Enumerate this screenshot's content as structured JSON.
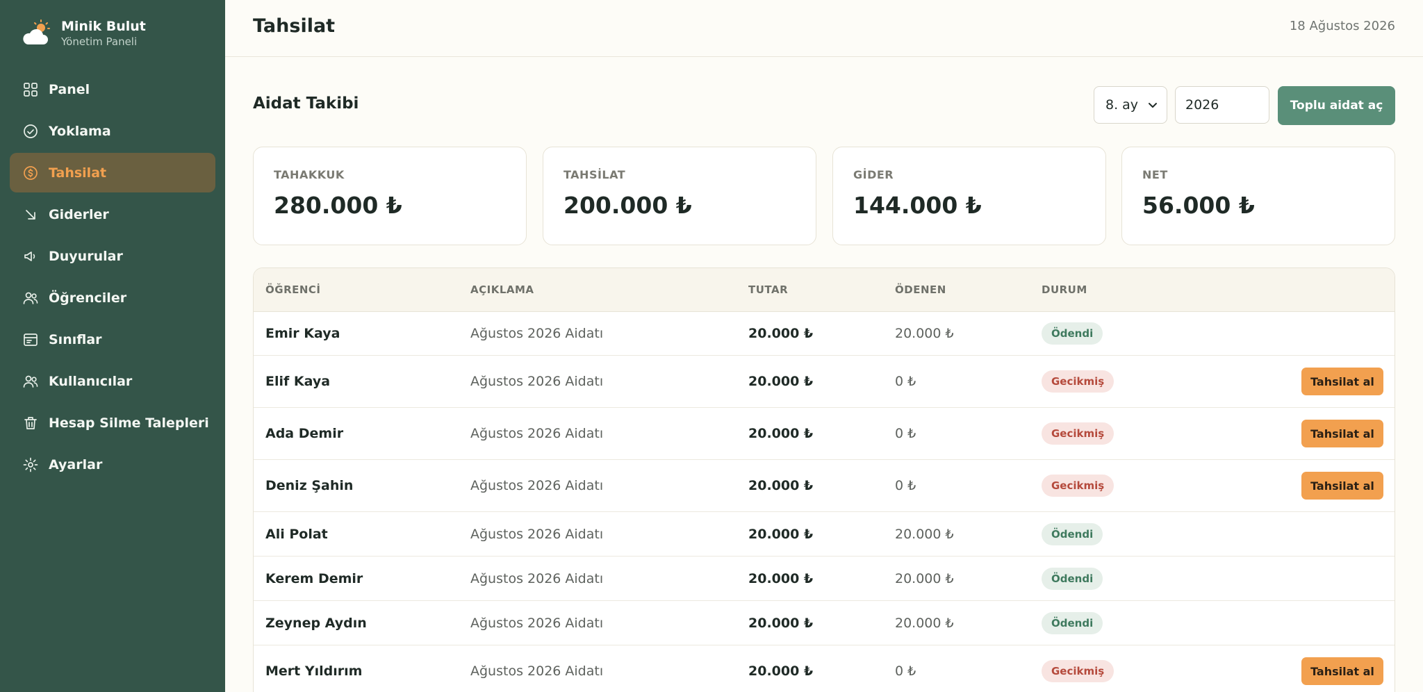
{
  "brand": {
    "name": "Minik Bulut",
    "subtitle": "Yönetim Paneli"
  },
  "nav": [
    {
      "label": "Panel",
      "icon": "grid-icon"
    },
    {
      "label": "Yoklama",
      "icon": "check-circle-icon"
    },
    {
      "label": "Tahsilat",
      "icon": "coin-icon",
      "active": true
    },
    {
      "label": "Giderler",
      "icon": "arrow-down-right-icon"
    },
    {
      "label": "Duyurular",
      "icon": "megaphone-icon"
    },
    {
      "label": "Öğrenciler",
      "icon": "users-icon"
    },
    {
      "label": "Sınıflar",
      "icon": "calendar-icon"
    },
    {
      "label": "Kullanıcılar",
      "icon": "users-icon"
    },
    {
      "label": "Hesap Silme Talepleri",
      "icon": "trash-icon"
    },
    {
      "label": "Ayarlar",
      "icon": "gear-icon"
    }
  ],
  "header": {
    "title": "Tahsilat",
    "date": "18 Ağustos 2026"
  },
  "section": {
    "title": "Aidat Takibi",
    "month_value": "8. ay",
    "year_value": "2026",
    "bulk_button": "Toplu aidat aç"
  },
  "stats": [
    {
      "label": "TAHAKKUK",
      "value": "280.000 ₺"
    },
    {
      "label": "TAHSİLAT",
      "value": "200.000 ₺"
    },
    {
      "label": "GİDER",
      "value": "144.000 ₺"
    },
    {
      "label": "NET",
      "value": "56.000 ₺"
    }
  ],
  "table": {
    "columns": [
      "ÖĞRENCİ",
      "AÇIKLAMA",
      "TUTAR",
      "ÖDENEN",
      "DURUM"
    ],
    "action_label": "Tahsilat al",
    "rows": [
      {
        "student": "Emir Kaya",
        "description": "Ağustos 2026 Aidatı",
        "amount": "20.000 ₺",
        "paid": "20.000 ₺",
        "status": "Ödendi",
        "state": "paid"
      },
      {
        "student": "Elif Kaya",
        "description": "Ağustos 2026 Aidatı",
        "amount": "20.000 ₺",
        "paid": "0 ₺",
        "status": "Gecikmiş",
        "state": "late"
      },
      {
        "student": "Ada Demir",
        "description": "Ağustos 2026 Aidatı",
        "amount": "20.000 ₺",
        "paid": "0 ₺",
        "status": "Gecikmiş",
        "state": "late"
      },
      {
        "student": "Deniz Şahin",
        "description": "Ağustos 2026 Aidatı",
        "amount": "20.000 ₺",
        "paid": "0 ₺",
        "status": "Gecikmiş",
        "state": "late"
      },
      {
        "student": "Ali Polat",
        "description": "Ağustos 2026 Aidatı",
        "amount": "20.000 ₺",
        "paid": "20.000 ₺",
        "status": "Ödendi",
        "state": "paid"
      },
      {
        "student": "Kerem Demir",
        "description": "Ağustos 2026 Aidatı",
        "amount": "20.000 ₺",
        "paid": "20.000 ₺",
        "status": "Ödendi",
        "state": "paid"
      },
      {
        "student": "Zeynep Aydın",
        "description": "Ağustos 2026 Aidatı",
        "amount": "20.000 ₺",
        "paid": "20.000 ₺",
        "status": "Ödendi",
        "state": "paid"
      },
      {
        "student": "Mert Yıldırım",
        "description": "Ağustos 2026 Aidatı",
        "amount": "20.000 ₺",
        "paid": "0 ₺",
        "status": "Gecikmiş",
        "state": "late"
      }
    ]
  },
  "colors": {
    "sidebar": "#345549",
    "accent": "#f2a04f",
    "primary_button": "#5a8f79",
    "paid_badge": "#3f7a5e",
    "late_badge": "#b54a3c"
  }
}
